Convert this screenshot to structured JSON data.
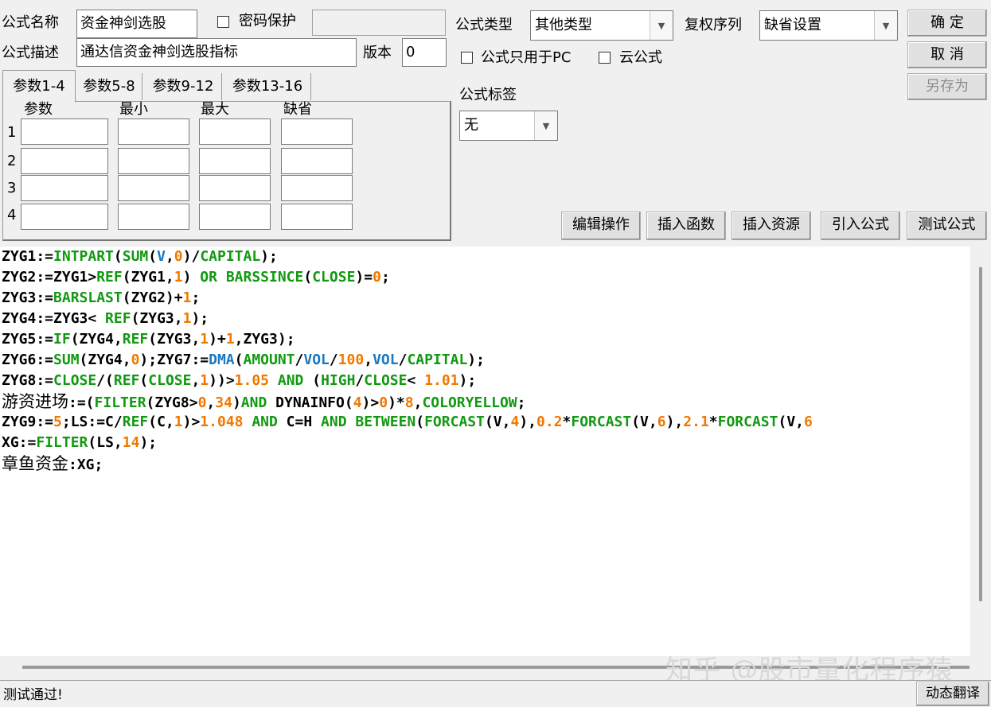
{
  "form": {
    "name_label": "公式名称",
    "name_value": "资金神剑选股",
    "password_label": "密码保护",
    "password_value": "",
    "desc_label": "公式描述",
    "desc_value": "通达信资金神剑选股指标",
    "version_label": "版本",
    "version_value": "0",
    "type_label": "公式类型",
    "type_value": "其他类型",
    "rights_label": "复权序列",
    "rights_value": "缺省设置",
    "pc_only_label": "公式只用于PC",
    "cloud_label": "云公式",
    "tag_label": "公式标签",
    "tag_value": "无"
  },
  "buttons": {
    "ok": "确 定",
    "cancel": "取 消",
    "save_as": "另存为",
    "edit_ops": "编辑操作",
    "insert_func": "插入函数",
    "insert_res": "插入资源",
    "import_formula": "引入公式",
    "test_formula": "测试公式",
    "translate": "动态翻译"
  },
  "params": {
    "tabs": [
      "参数1-4",
      "参数5-8",
      "参数9-12",
      "参数13-16"
    ],
    "headers": [
      "参数",
      "最小",
      "最大",
      "缺省"
    ],
    "rows": [
      "1",
      "2",
      "3",
      "4"
    ]
  },
  "code": {
    "l1": [
      "ZYG1:=",
      "INTPART",
      "(",
      "SUM",
      "(",
      "V",
      ",",
      "0",
      ")/",
      "CAPITAL",
      ");"
    ],
    "l2": [
      "ZYG2:=ZYG1>",
      "REF",
      "(ZYG1,",
      "1",
      ") ",
      "OR",
      " ",
      "BARSSINCE",
      "(",
      "CLOSE",
      ")=",
      "0",
      ";"
    ],
    "l3": [
      "ZYG3:=",
      "BARSLAST",
      "(ZYG2)+",
      "1",
      ";"
    ],
    "l4": [
      "ZYG4:=ZYG3< ",
      "REF",
      "(ZYG3,",
      "1",
      ");"
    ],
    "l5": [
      "ZYG5:=",
      "IF",
      "(ZYG4,",
      "REF",
      "(ZYG3,",
      "1",
      ")+",
      "1",
      ",ZYG3);"
    ],
    "l6": [
      "ZYG6:=",
      "SUM",
      "(ZYG4,",
      "0",
      ");ZYG7:=",
      "DMA",
      "(",
      "AMOUNT",
      "/",
      "VOL",
      "/",
      "100",
      ",",
      "VOL",
      "/",
      "CAPITAL",
      ");"
    ],
    "l7": [
      "ZYG8:=",
      "CLOSE",
      "/(",
      "REF",
      "(",
      "CLOSE",
      ",",
      "1",
      "))>",
      "1.05",
      " ",
      "AND",
      " (",
      "HIGH",
      "/",
      "CLOSE",
      "< ",
      "1.01",
      ");"
    ],
    "l8": [
      "游资进场",
      ":=(",
      "FILTER",
      "(ZYG8>",
      "0",
      ",",
      "34",
      ")",
      "AND",
      " DYNAINFO(",
      "4",
      ")>",
      "0",
      ")*",
      "8",
      ",",
      "COLORYELLOW",
      ";"
    ],
    "l9": [
      "ZYG9:=",
      "5",
      ";LS:=C/",
      "REF",
      "(C,",
      "1",
      ")>",
      "1.048",
      " ",
      "AND",
      " C=H ",
      "AND",
      " ",
      "BETWEEN",
      "(",
      "FORCAST",
      "(V,",
      "4",
      "),",
      "0.2",
      "*",
      "FORCAST",
      "(V,",
      "6",
      "),",
      "2.1",
      "*",
      "FORCAST",
      "(V,",
      "6"
    ],
    "l10": [
      "XG:=",
      "FILTER",
      "(LS,",
      "14",
      ");"
    ],
    "l11": [
      "章鱼资金",
      ":XG;"
    ]
  },
  "watermark": "知乎 @股市量化程序猿",
  "status": "测试通过!"
}
